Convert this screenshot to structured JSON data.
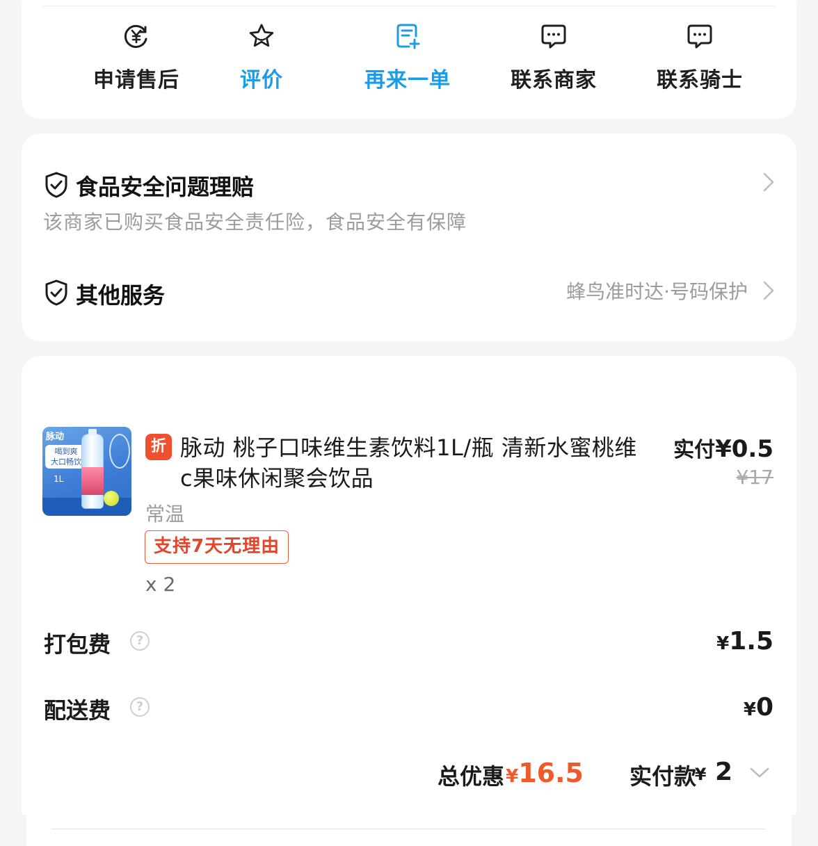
{
  "actions": [
    {
      "label": "申请售后",
      "icon": "yen-refund-icon",
      "color": "#1f1f1f"
    },
    {
      "label": "评价",
      "icon": "star-icon",
      "color": "#1a9ce8"
    },
    {
      "label": "再来一单",
      "icon": "reorder-icon",
      "color": "#1a9ce8"
    },
    {
      "label": "联系商家",
      "icon": "chat-icon",
      "color": "#1f1f1f"
    },
    {
      "label": "联系骑士",
      "icon": "chat-icon",
      "color": "#1f1f1f"
    }
  ],
  "services": {
    "food_safety_title": "食品安全问题理赔",
    "food_safety_desc": "该商家已购买食品安全责任险，食品安全有保障",
    "other_title": "其他服务",
    "other_value": "蜂鸟准时达·号码保护"
  },
  "order": {
    "product": {
      "discount_tag": "折",
      "name": "脉动 桃子口味维生素饮料1L/瓶 清新水蜜桃维c果味休闲聚会饮品",
      "paid_label": "实付",
      "paid_price": "¥0.5",
      "original_price": "¥17",
      "spec": "常温",
      "return_badge": "支持7天无理由",
      "quantity": "x 2",
      "image_texts": {
        "brand": "脉动",
        "slogan_line1": "喝到爽",
        "slogan_line2": "大口畅饮",
        "volume": "1L"
      }
    },
    "fees": [
      {
        "label": "打包费",
        "help": "?",
        "yen": "¥",
        "value": "1.5"
      },
      {
        "label": "配送费",
        "help": "?",
        "yen": "¥",
        "value": "0"
      }
    ],
    "summary": {
      "discount_label": "总优惠",
      "discount_yen": "¥",
      "discount_value": "16.5",
      "paid_label": "实付款",
      "paid_yen": "¥",
      "paid_value": "2"
    }
  },
  "colors": {
    "accent_blue": "#1a9ce8",
    "accent_orange": "#f05a2a",
    "tag_red": "#f1502e"
  }
}
